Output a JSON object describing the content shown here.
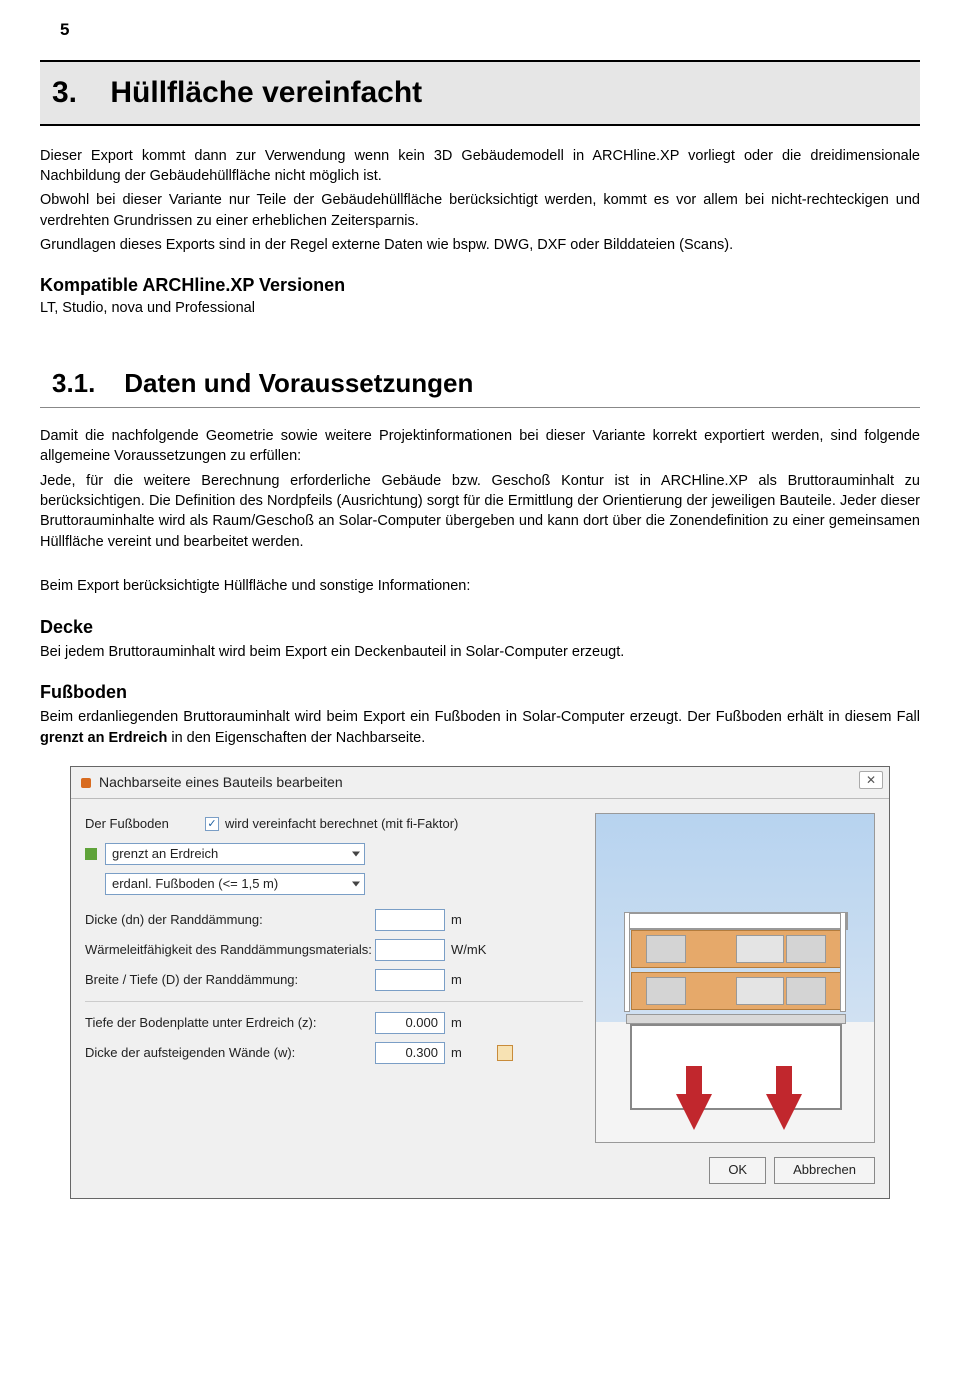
{
  "page_number": "5",
  "chapter": {
    "num": "3.",
    "title": "Hüllfläche vereinfacht"
  },
  "intro": {
    "p1": "Dieser Export kommt dann zur Verwendung wenn kein 3D Gebäudemodell in ARCHline.XP vorliegt oder die dreidimensionale Nachbildung der Gebäudehüllfläche nicht möglich ist.",
    "p2": "Obwohl bei dieser Variante nur Teile der Gebäudehüllfläche berücksichtigt werden, kommt es vor allem bei nicht-rechteckigen und verdrehten Grundrissen zu einer erheblichen Zeitersparnis.",
    "p3": "Grundlagen dieses Exports sind in der Regel externe Daten wie bspw. DWG, DXF oder Bilddateien (Scans)."
  },
  "compat": {
    "heading": "Kompatible ARCHline.XP Versionen",
    "text": "LT, Studio, nova und Professional"
  },
  "section": {
    "num": "3.1.",
    "title": "Daten und Voraussetzungen"
  },
  "sec_body": {
    "p1": "Damit die nachfolgende Geometrie sowie weitere Projektinformationen bei dieser Variante korrekt exportiert werden, sind folgende allgemeine Voraussetzungen zu erfüllen:",
    "p2": "Jede, für die weitere Berechnung erforderliche Gebäude bzw. Geschoß Kontur ist in ARCHline.XP als Bruttorauminhalt zu berücksichtigen. Die Definition des Nordpfeils (Ausrichtung) sorgt für die Ermittlung der Orientierung der jeweiligen Bauteile. Jeder dieser Bruttorauminhalte wird als Raum/Geschoß an Solar-Computer übergeben und kann dort über die Zonendefinition zu einer gemeinsamen Hüllfläche vereint und bearbeitet werden.",
    "p3": "Beim Export berücksichtigte Hüllfläche und sonstige Informationen:"
  },
  "decke": {
    "heading": "Decke",
    "text": "Bei jedem Bruttorauminhalt wird beim Export ein Deckenbauteil in Solar-Computer erzeugt."
  },
  "fussboden": {
    "heading": "Fußboden",
    "text_a": "Beim erdanliegenden Bruttorauminhalt wird beim Export ein Fußboden in Solar-Computer erzeugt. Der Fußboden erhält in diesem Fall ",
    "text_bold": "grenzt an Erdreich",
    "text_b": " in den Eigenschaften der Nachbarseite."
  },
  "dialog": {
    "title": "Nachbarseite eines Bauteils bearbeiten",
    "close": "✕",
    "component_label": "Der Fußboden",
    "simplified_check": "✓",
    "simplified_label": "wird vereinfacht berechnet (mit fi-Faktor)",
    "combo1": "grenzt an Erdreich",
    "combo2": "erdanl. Fußboden (<= 1,5 m)",
    "row_dn": "Dicke (dn) der Randdämmung:",
    "row_lambda": "Wärmeleitfähigkeit des Randdämmungsmaterials:",
    "row_bd": "Breite / Tiefe (D) der Randdämmung:",
    "row_z": "Tiefe der Bodenplatte unter Erdreich (z):",
    "row_w": "Dicke der aufsteigenden Wände (w):",
    "val_z": "0.000",
    "val_w": "0.300",
    "unit_m": "m",
    "unit_wmk": "W/mK",
    "ok": "OK",
    "cancel": "Abbrechen"
  }
}
